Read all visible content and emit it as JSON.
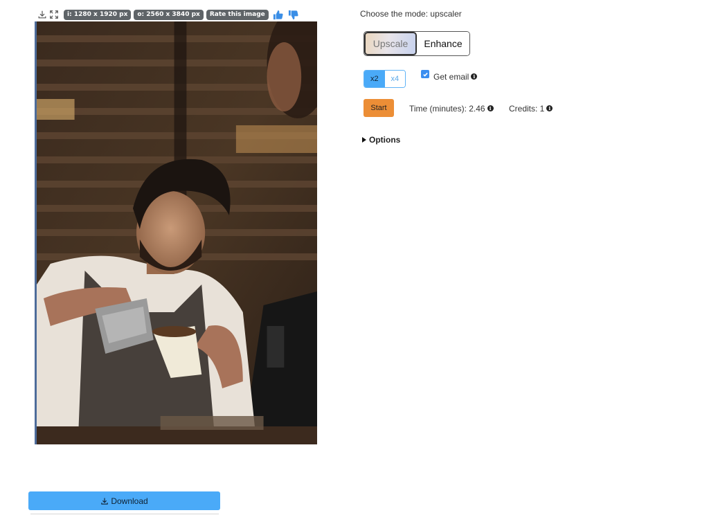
{
  "toolbar": {
    "icons": [
      "download-icon",
      "fullscreen-icon"
    ],
    "input_size": "i: 1280 x 1920 px",
    "output_size": "o: 2560 x 3840 px",
    "rate_label": "Rate this image",
    "thumb_up": "thumbs-up-icon",
    "thumb_down": "thumbs-down-icon",
    "accent_color": "#3a8ee6"
  },
  "photo": {
    "description_icon": "image-preview"
  },
  "download": {
    "label": "Download",
    "icon": "download-icon",
    "color": "#4aaaf8"
  },
  "mode": {
    "title": "Choose the mode: upscaler",
    "options": [
      "Upscale",
      "Enhance"
    ],
    "selected": "Upscale"
  },
  "scale": {
    "options": [
      "x2",
      "x4"
    ],
    "selected": "x2"
  },
  "email": {
    "label": "Get email",
    "checked": true
  },
  "start": {
    "label": "Start",
    "color": "#ec8e36"
  },
  "stats": {
    "time_label": "Time (minutes): 2.46",
    "credits_label": "Credits: 1"
  },
  "options": {
    "label": "Options"
  },
  "info_glyph": "i"
}
